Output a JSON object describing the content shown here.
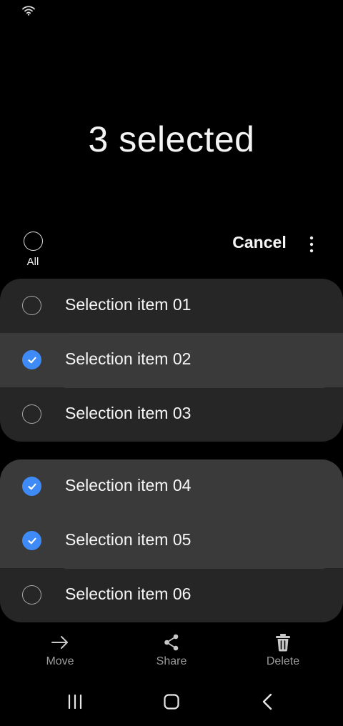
{
  "status_bar": {
    "icons": [
      "wifi-icon"
    ]
  },
  "header": {
    "title": "3 selected"
  },
  "toolbar": {
    "select_all_label": "All",
    "cancel_label": "Cancel",
    "more_icon": "more-vertical-icon"
  },
  "groups": [
    {
      "items": [
        {
          "label": "Selection item 01",
          "selected": false
        },
        {
          "label": "Selection item 02",
          "selected": true
        },
        {
          "label": "Selection item 03",
          "selected": false
        }
      ]
    },
    {
      "items": [
        {
          "label": "Selection item 04",
          "selected": true
        },
        {
          "label": "Selection item 05",
          "selected": true
        },
        {
          "label": "Selection item 06",
          "selected": false
        }
      ]
    }
  ],
  "bottom_actions": [
    {
      "label": "Move",
      "icon": "arrow-right-icon"
    },
    {
      "label": "Share",
      "icon": "share-icon"
    },
    {
      "label": "Delete",
      "icon": "trash-icon"
    }
  ],
  "nav_bar": {
    "icons": [
      "recents-icon",
      "home-icon",
      "back-icon"
    ]
  },
  "colors": {
    "background": "#000000",
    "group_background": "#262626",
    "selected_row": "#3a3a3a",
    "accent": "#3e8af6",
    "muted_text": "#9b9b9b"
  }
}
